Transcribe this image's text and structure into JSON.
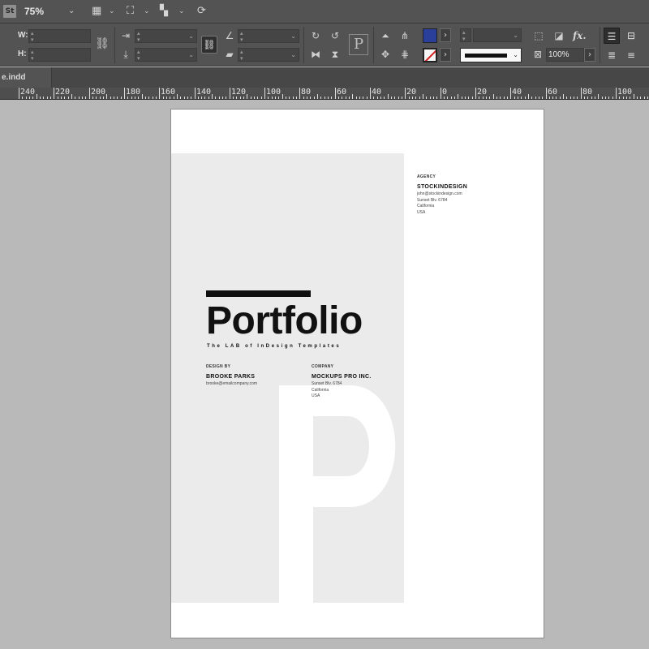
{
  "appbar": {
    "logo": "St",
    "zoom": "75%"
  },
  "control": {
    "w_label": "W:",
    "h_label": "H:",
    "opacity": "100%",
    "fx_label": "fx.",
    "fill_color": "#2a3f9a",
    "stroke_color": "#d21e1e"
  },
  "tab": {
    "filename": "e.indd"
  },
  "ruler": {
    "labels": [
      "240",
      "220",
      "200",
      "180",
      "160",
      "140",
      "120",
      "100",
      "80",
      "60",
      "40",
      "20",
      "0",
      "20",
      "40",
      "60",
      "80",
      "100"
    ]
  },
  "document": {
    "agency": {
      "label": "AGENCY",
      "name": "STOCKINDESIGN",
      "email": "john@stockindesign.com",
      "address": "Sunset Blv. 6784",
      "state": "California",
      "country": "USA"
    },
    "title": "Portfolio",
    "subtitle": "The LAB of InDesign Templates",
    "design_by": {
      "label": "DESIGN BY",
      "name": "BROOKE PARKS",
      "email": "brooke@emailcompany.com"
    },
    "company": {
      "label": "COMPANY",
      "name": "MOCKUPS PRO INC.",
      "address": "Sunset Blv. 6784",
      "state": "California",
      "country": "USA"
    },
    "big_letter": "P"
  }
}
